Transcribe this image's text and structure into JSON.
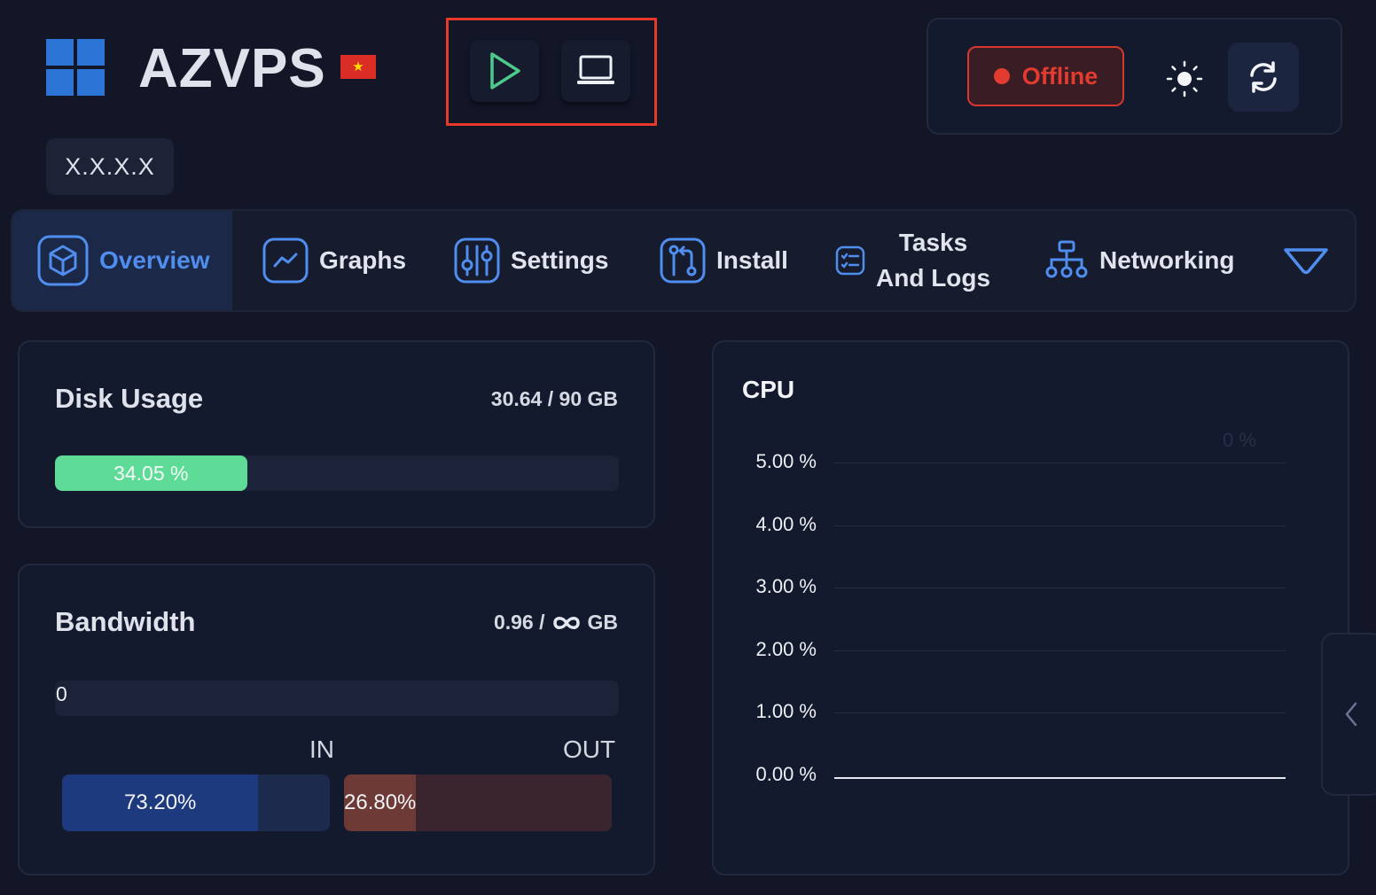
{
  "header": {
    "app_title": "AZVPS",
    "flag_symbol": "★",
    "ip_address": "X.X.X.X"
  },
  "actions": {
    "start_icon": "play-icon",
    "console_icon": "laptop-icon"
  },
  "status": {
    "label": "Offline",
    "color": "#e23b2f",
    "theme_icon": "sun-icon",
    "refresh_icon": "refresh-icon"
  },
  "tabs": [
    {
      "label": "Overview",
      "icon": "cube-icon",
      "active": true
    },
    {
      "label": "Graphs",
      "icon": "trend-icon",
      "active": false
    },
    {
      "label": "Settings",
      "icon": "sliders-icon",
      "active": false
    },
    {
      "label": "Install",
      "icon": "git-compare-icon",
      "active": false
    },
    {
      "label_line1": "Tasks",
      "label_line2": "And Logs",
      "icon": "checklist-icon",
      "active": false
    },
    {
      "label": "Networking",
      "icon": "network-icon",
      "active": false
    },
    {
      "icon": "chevron-down-icon",
      "active": false
    }
  ],
  "disk": {
    "title": "Disk Usage",
    "usage_text": "30.64 / 90 GB",
    "percent_text": "34.05 %",
    "percent": 34.05,
    "color": "#5ddb97"
  },
  "bandwidth": {
    "title": "Bandwidth",
    "used": "0.96 /",
    "unit": "GB",
    "limit_icon": "infinity-icon",
    "bar_value": "0",
    "in_label": "IN",
    "out_label": "OUT",
    "in_percent_text": "73.20%",
    "in_percent": 73.2,
    "out_percent_text": "26.80%",
    "out_percent": 26.8
  },
  "cpu": {
    "title": "CPU",
    "ghost_label": "0 %"
  },
  "chart_data": {
    "type": "line",
    "title": "CPU",
    "yticks": [
      "5.00 %",
      "4.00 %",
      "3.00 %",
      "2.00 %",
      "1.00 %",
      "0.00 %"
    ],
    "ylim": [
      0,
      5
    ],
    "series": [
      {
        "values": [
          0,
          0
        ]
      }
    ],
    "grid": true
  },
  "side_handle_icon": "chevron-left-icon"
}
